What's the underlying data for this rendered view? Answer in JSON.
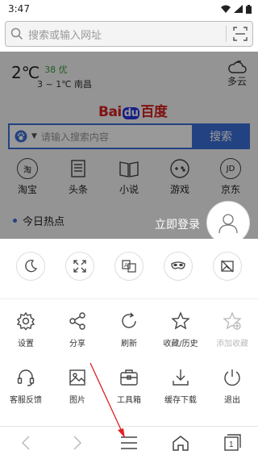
{
  "status": {
    "time": "3:47"
  },
  "urlbar": {
    "placeholder": "搜索或输入网址"
  },
  "weather": {
    "temp": "2℃",
    "aqi": "38 优",
    "range": "3 ~ 1℃ 南昌",
    "condition": "多云"
  },
  "home": {
    "logo_text": "Bai",
    "logo_du": "du",
    "logo_cn": "百度",
    "search_placeholder": "请输入搜索内容",
    "search_button": "搜索",
    "quick_links": [
      "淘宝",
      "头条",
      "小说",
      "游戏",
      "京东"
    ],
    "hot_label": "今日热点"
  },
  "login": {
    "label": "立即登录"
  },
  "menu": {
    "row1": [
      "设置",
      "分享",
      "刷新",
      "收藏/历史",
      "添加收藏"
    ],
    "row2": [
      "客服反馈",
      "图片",
      "工具箱",
      "缓存下载",
      "退出"
    ]
  },
  "tabs": {
    "count": "1"
  },
  "colors": {
    "accent": "#3b6fd8",
    "aqi_green": "#3a9a3a",
    "annotation_red": "#e02020"
  }
}
